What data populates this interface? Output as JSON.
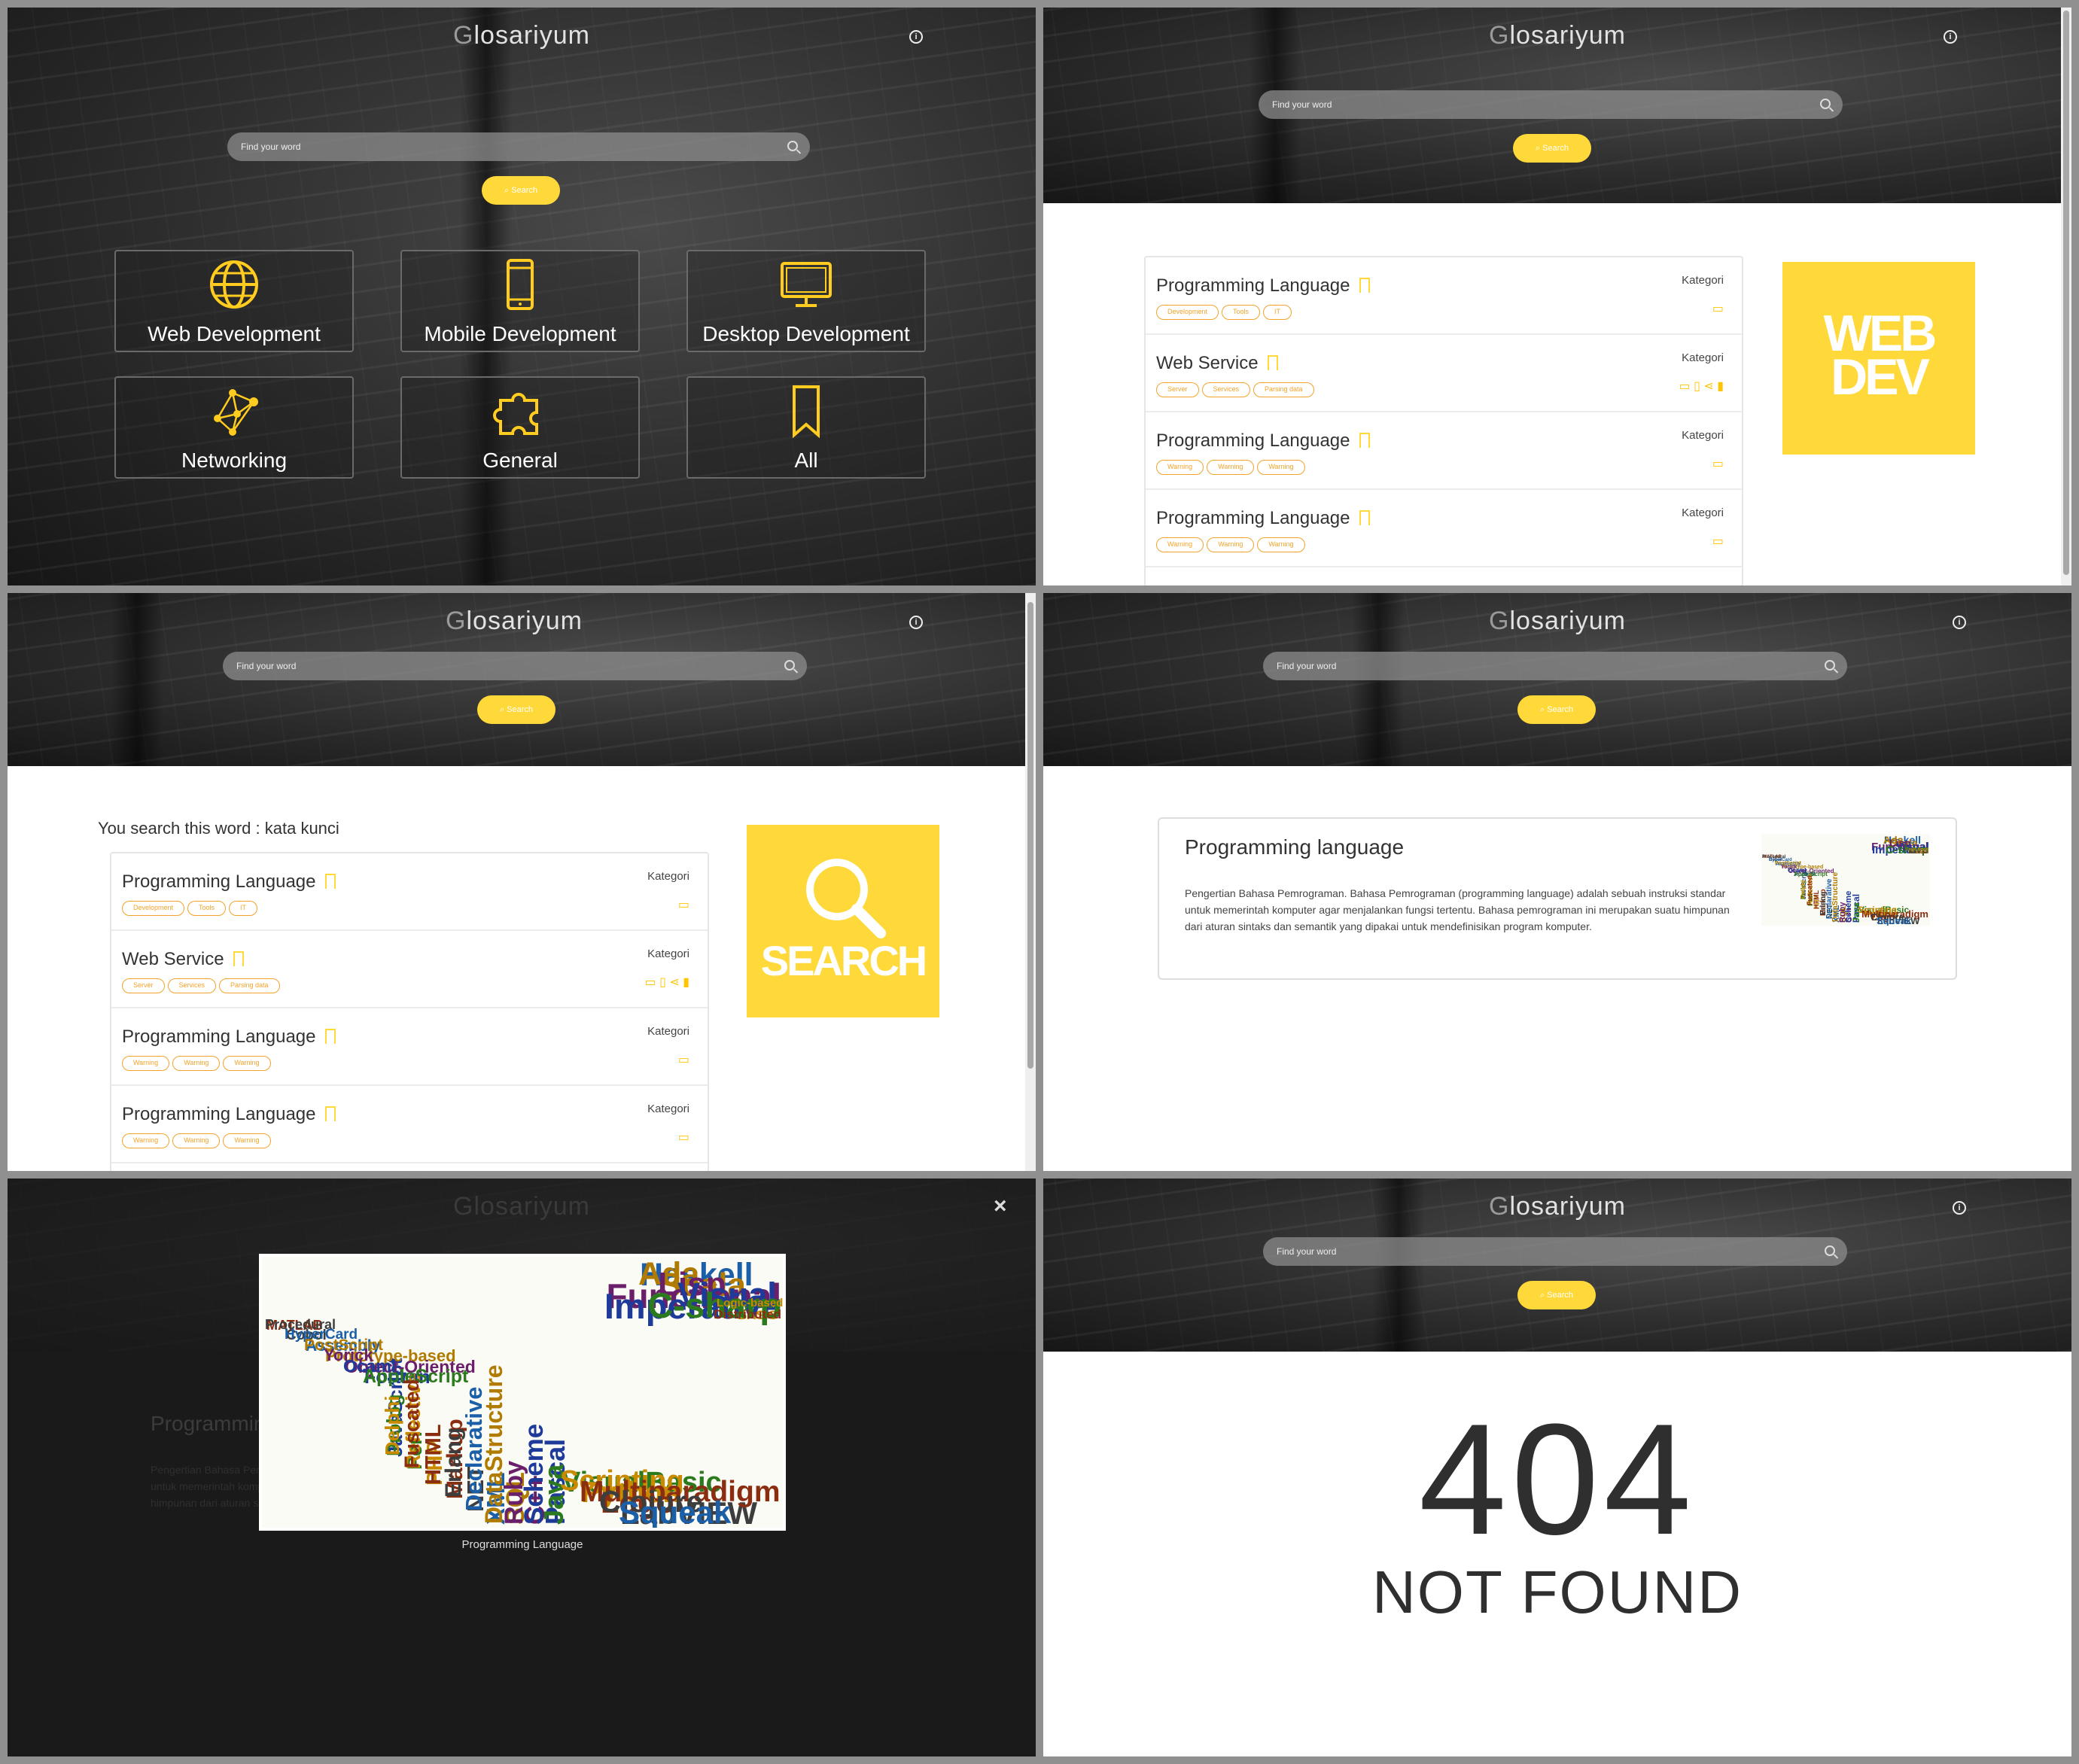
{
  "app": {
    "logo_first": "G",
    "logo_rest": "losariyum"
  },
  "search": {
    "placeholder": "Find your word",
    "button_label": "Search"
  },
  "home": {
    "categories": [
      {
        "label": "Web Development",
        "icon": "globe-icon"
      },
      {
        "label": "Mobile Development",
        "icon": "smartphone-icon"
      },
      {
        "label": "Desktop Development",
        "icon": "monitor-icon"
      },
      {
        "label": "Networking",
        "icon": "network-icon"
      },
      {
        "label": "General",
        "icon": "puzzle-icon"
      },
      {
        "label": "All",
        "icon": "bookmark-icon"
      }
    ]
  },
  "list": {
    "kategori_label": "Kategori",
    "items": [
      {
        "title": "Programming Language",
        "tags": [
          "Development",
          "Tools",
          "IT"
        ],
        "icons": [
          "monitor-icon"
        ]
      },
      {
        "title": "Web Service",
        "tags": [
          "Server",
          "Services",
          "Parsing data"
        ],
        "icons": [
          "monitor-icon",
          "smartphone-icon",
          "share-icon",
          "bookmark-icon"
        ]
      },
      {
        "title": "Programming Language",
        "tags": [
          "Warning",
          "Warning",
          "Warning"
        ],
        "icons": [
          "monitor-icon"
        ]
      },
      {
        "title": "Programming Language",
        "tags": [
          "Warning",
          "Warning",
          "Warning"
        ],
        "icons": [
          "monitor-icon"
        ]
      }
    ]
  },
  "category_page": {
    "badge_line1": "WEB",
    "badge_line2": "DEV"
  },
  "search_page": {
    "heading": "You search this word : kata kunci",
    "badge_label": "SEARCH"
  },
  "detail": {
    "title": "Programming language",
    "body": "Pengertian Bahasa Pemrograman. Bahasa Pemrograman (programming language) adalah sebuah instruksi standar untuk memerintah komputer agar menjalankan fungsi tertentu. Bahasa pemrograman ini merupakan suatu himpunan dari aturan sintaks dan semantik yang dipakai untuk mendefinisikan program komputer."
  },
  "lightbox": {
    "caption": "Programming Language",
    "close_label": "×"
  },
  "not_found": {
    "code": "404",
    "message": "NOT FOUND"
  },
  "colors": {
    "accent": "#ffd83a",
    "tag": "#f3a32b",
    "dark": "#2a2a2a"
  },
  "wordcloud": [
    "JavaScript",
    "Perl",
    "PHP",
    "Markup",
    "NET",
    "XML",
    "SQL",
    "C++",
    "Pascal",
    "VisualBasic",
    "Python",
    "Logo",
    "LabVIEW",
    "Haskell",
    "Scala",
    "Functional",
    "Imperative",
    "Interpreted",
    "BASIC",
    "MATLAB",
    "Cobol",
    "Assembly",
    "Prototype-based",
    "Object-Oriented",
    "Fortran",
    "Prolog",
    "Reflective",
    "HTML",
    "Erlang",
    "Declarative",
    "DataStructure",
    "Ruby",
    "Scheme",
    "Java",
    "Scripting",
    "Multiparadigm",
    "Clojure",
    "Squeak",
    "Ada",
    "Lisp",
    "Visual",
    "C-sharp",
    "Logic-based",
    "Distributed",
    "Procedural",
    "HyperCard",
    "PostScript",
    "Yorick",
    "Ocaml",
    "AppleScript",
    "Delphi",
    "Fuscated"
  ]
}
